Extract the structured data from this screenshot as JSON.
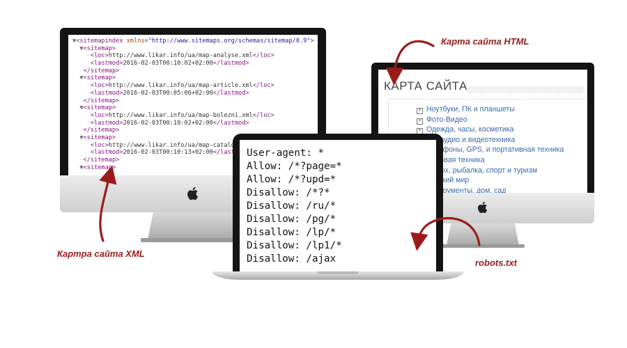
{
  "xml_lines": [
    {
      "indent": 0,
      "tri": "▼",
      "parts": [
        [
          "tag",
          "<sitemapindex "
        ],
        [
          "atn",
          "xmlns"
        ],
        [
          "tag",
          "="
        ],
        [
          "atv",
          "\"http://www.sitemaps.org/schemas/sitemap/0.9\""
        ],
        [
          "tag",
          ">"
        ]
      ]
    },
    {
      "indent": 1,
      "tri": "▼",
      "parts": [
        [
          "tag",
          "<sitemap>"
        ]
      ]
    },
    {
      "indent": 2,
      "tri": "",
      "parts": [
        [
          "tag",
          "<loc>"
        ],
        [
          "txt",
          "http://www.likar.info/ua/map-analyse.xml"
        ],
        [
          "tag",
          "</loc>"
        ]
      ]
    },
    {
      "indent": 2,
      "tri": "",
      "parts": [
        [
          "tag",
          "<lastmod>"
        ],
        [
          "txt",
          "2016-02-03T00:10:02+02:00"
        ],
        [
          "tag",
          "</lastmod>"
        ]
      ]
    },
    {
      "indent": 1,
      "tri": "",
      "parts": [
        [
          "tag",
          "</sitemap>"
        ]
      ]
    },
    {
      "indent": 1,
      "tri": "▼",
      "parts": [
        [
          "tag",
          "<sitemap>"
        ]
      ]
    },
    {
      "indent": 2,
      "tri": "",
      "parts": [
        [
          "tag",
          "<loc>"
        ],
        [
          "txt",
          "http://www.likar.info/ua/map-article.xml"
        ],
        [
          "tag",
          "</loc>"
        ]
      ]
    },
    {
      "indent": 2,
      "tri": "",
      "parts": [
        [
          "tag",
          "<lastmod>"
        ],
        [
          "txt",
          "2016-02-03T00:05:06+02:00"
        ],
        [
          "tag",
          "</lastmod>"
        ]
      ]
    },
    {
      "indent": 1,
      "tri": "",
      "parts": [
        [
          "tag",
          "</sitemap>"
        ]
      ]
    },
    {
      "indent": 1,
      "tri": "▼",
      "parts": [
        [
          "tag",
          "<sitemap>"
        ]
      ]
    },
    {
      "indent": 2,
      "tri": "",
      "parts": [
        [
          "tag",
          "<loc>"
        ],
        [
          "txt",
          "http://www.likar.info/ua/map-bolezni.xml"
        ],
        [
          "tag",
          "</loc>"
        ]
      ]
    },
    {
      "indent": 2,
      "tri": "",
      "parts": [
        [
          "tag",
          "<lastmod>"
        ],
        [
          "txt",
          "2016-02-03T00:10:02+02:00"
        ],
        [
          "tag",
          "</lastmod>"
        ]
      ]
    },
    {
      "indent": 1,
      "tri": "",
      "parts": [
        [
          "tag",
          "</sitemap>"
        ]
      ]
    },
    {
      "indent": 1,
      "tri": "▼",
      "parts": [
        [
          "tag",
          "<sitemap>"
        ]
      ]
    },
    {
      "indent": 2,
      "tri": "",
      "parts": [
        [
          "tag",
          "<loc>"
        ],
        [
          "txt",
          "http://www.likar.info/ua/map-catalog"
        ]
      ]
    },
    {
      "indent": 2,
      "tri": "",
      "parts": [
        [
          "tag",
          "<lastmod>"
        ],
        [
          "txt",
          "2016-02-03T00:10:13+02:00"
        ],
        [
          "tag",
          "</lastmod>"
        ]
      ]
    },
    {
      "indent": 1,
      "tri": "",
      "parts": [
        [
          "tag",
          "</sitemap>"
        ]
      ]
    },
    {
      "indent": 1,
      "tri": "▼",
      "parts": [
        [
          "tag",
          "<sitemap>"
        ]
      ]
    }
  ],
  "sitemap_html": {
    "title": "КАРТА САЙТА",
    "items": [
      "Ноутбуки, ПК и планшеты",
      "Фото-Видео",
      "Одежда, часы, косметика",
      "ТВ, аудио и видеотехника",
      "Телефоны, GPS, и портативная техника",
      "Бытовая техника",
      "Отдых, рыбалка, спорт и туризм",
      "Детский мир",
      "Инструменты, дом, сад"
    ]
  },
  "robots_lines": [
    "User-agent: *",
    "Allow: /*?page=*",
    "Allow: /*?upd=*",
    "Disallow: /*?*",
    "Disallow: /ru/*",
    "Disallow: /pg/*",
    "Disallow: /lp/*",
    "Disallow: /lp1/*",
    "Disallow: /ajax"
  ],
  "labels": {
    "xml": "Картра сайта XML",
    "html": "Карта сайта HTML",
    "robots": "robots.txt"
  },
  "icons": {
    "apple": "apple-logo-icon",
    "arrow": "curved-arrow-icon"
  },
  "colors": {
    "accent": "#9b1b1b",
    "link": "#3b6aa8"
  }
}
